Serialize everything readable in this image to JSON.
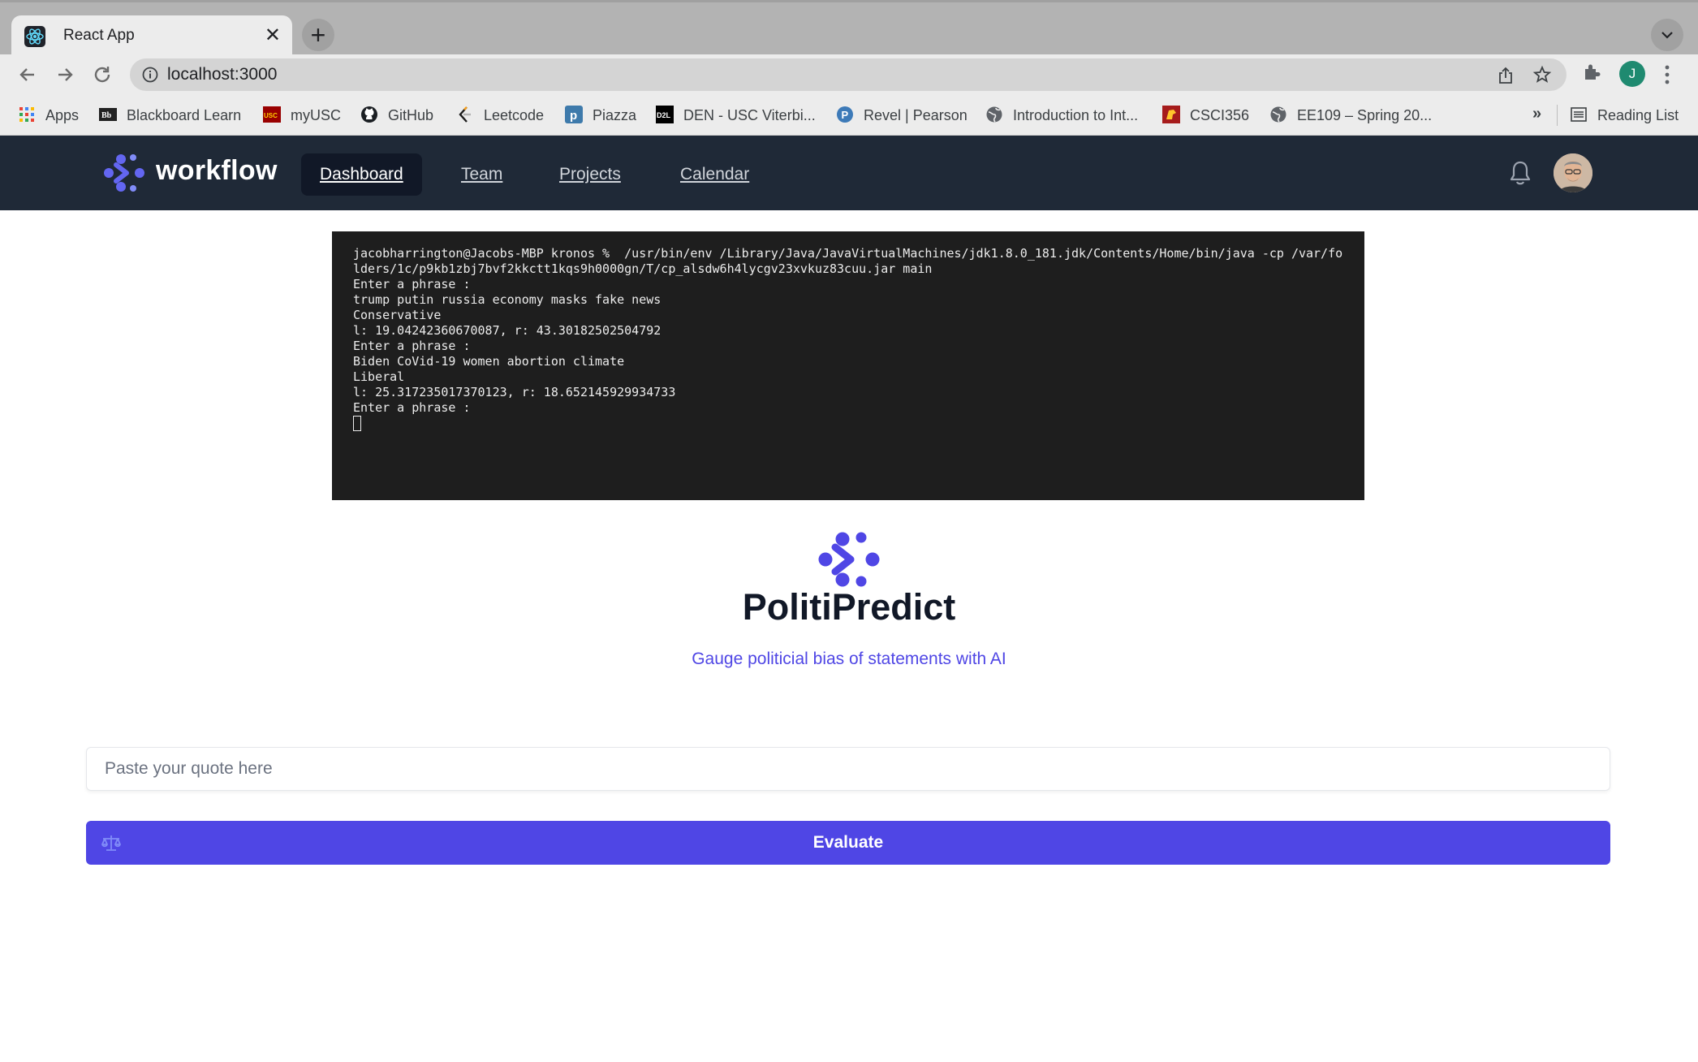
{
  "browser": {
    "tab_title": "React App",
    "url": "localhost:3000",
    "profile_initial": "J",
    "bookmarks": [
      {
        "label": "Apps",
        "icon": "apps-grid-icon"
      },
      {
        "label": "Blackboard Learn",
        "icon": "blackboard-icon"
      },
      {
        "label": "myUSC",
        "icon": "usc-icon"
      },
      {
        "label": "GitHub",
        "icon": "github-icon"
      },
      {
        "label": "Leetcode",
        "icon": "leetcode-icon"
      },
      {
        "label": "Piazza",
        "icon": "piazza-icon"
      },
      {
        "label": "DEN - USC Viterbi...",
        "icon": "d2l-icon"
      },
      {
        "label": "Revel | Pearson",
        "icon": "pearson-icon"
      },
      {
        "label": "Introduction to Int...",
        "icon": "globe-icon"
      },
      {
        "label": "CSCI356",
        "icon": "usc-trojan-icon"
      },
      {
        "label": "EE109 – Spring 20...",
        "icon": "globe-icon"
      }
    ],
    "more_label": "»",
    "reading_list": "Reading List"
  },
  "nav": {
    "brand": "workflow",
    "links": [
      "Dashboard",
      "Team",
      "Projects",
      "Calendar"
    ],
    "active_index": 0
  },
  "terminal": {
    "lines": [
      "jacobharrington@Jacobs-MBP kronos %  /usr/bin/env /Library/Java/JavaVirtualMachines/jdk1.8.0_181.jdk/Contents/Home/bin/java -cp /var/folders/1c/p9kb1zbj7bvf2kkctt1kqs9h0000gn/T/cp_alsdw6h4lycgv23xvkuz83cuu.jar main",
      "Enter a phrase :",
      "trump putin russia economy masks fake news",
      "Conservative",
      "l: 19.04242360670087, r: 43.30182502504792",
      "Enter a phrase :",
      "Biden CoVid-19 women abortion climate",
      "Liberal",
      "l: 25.317235017370123, r: 18.652145929934733",
      "Enter a phrase :"
    ]
  },
  "hero": {
    "title": "PolitiPredict",
    "subtitle": "Gauge politicial bias of statements with AI"
  },
  "form": {
    "placeholder": "Paste your quote here",
    "value": "",
    "button_label": "Evaluate"
  },
  "colors": {
    "accent": "#4f46e5",
    "nav_bg": "#1f2937",
    "terminal_bg": "#1e1e1e"
  }
}
